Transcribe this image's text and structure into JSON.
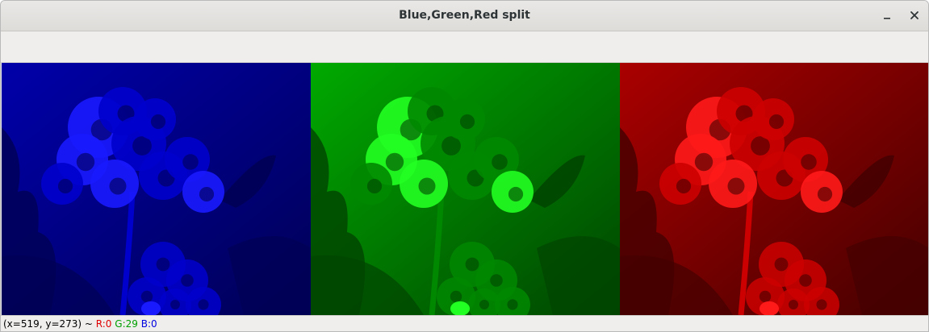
{
  "window": {
    "title": "Blue,Green,Red split",
    "minimize_icon": "minimize-icon",
    "close_icon": "close-icon"
  },
  "channels": [
    {
      "name": "blue",
      "base": "#0000aa",
      "dark": "#000055",
      "bright": "#1a1aff",
      "mid": "#0000cc"
    },
    {
      "name": "green",
      "base": "#00aa00",
      "dark": "#004400",
      "bright": "#22ff22",
      "mid": "#008800"
    },
    {
      "name": "red",
      "base": "#aa0000",
      "dark": "#440000",
      "bright": "#ff1a1a",
      "mid": "#cc0000"
    }
  ],
  "status": {
    "coords": "(x=519, y=273) ~ ",
    "r": "R:0",
    "g": "G:29",
    "b": "B:0",
    "r_color": "#e00000",
    "g_color": "#00a000",
    "b_color": "#0000e0"
  }
}
